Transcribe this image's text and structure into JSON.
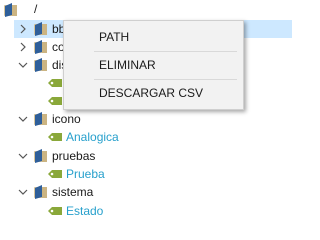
{
  "tree": {
    "root": {
      "label": "/"
    },
    "nodes": [
      {
        "label": "bb",
        "expanded": false,
        "selected": true
      },
      {
        "label": "co",
        "expanded": false
      },
      {
        "label": "dis",
        "expanded": true,
        "children": [
          {
            "label": ""
          },
          {
            "label": ""
          }
        ]
      },
      {
        "label": "icono",
        "expanded": true,
        "children": [
          {
            "label": "Analogica"
          }
        ]
      },
      {
        "label": "pruebas",
        "expanded": true,
        "children": [
          {
            "label": "Prueba"
          }
        ]
      },
      {
        "label": "sistema",
        "expanded": true,
        "children": [
          {
            "label": "Estado"
          }
        ]
      }
    ]
  },
  "context_menu": {
    "items": [
      {
        "label": "PATH"
      },
      {
        "label": "ELIMINAR"
      },
      {
        "label": "DESCARGAR CSV"
      }
    ]
  },
  "colors": {
    "selection": "#cde8ff",
    "leaf_text": "#27a0cc",
    "folder_blue": "#2f5f9a",
    "folder_tan": "#d8c59a",
    "leaf_green": "#8aa83a",
    "menu_bg": "#f2f2f2"
  },
  "icons": {
    "folder": "database-folder-icon",
    "leaf": "tag-leaf-icon",
    "collapsed": "chevron-right-icon",
    "expanded": "chevron-down-icon"
  }
}
